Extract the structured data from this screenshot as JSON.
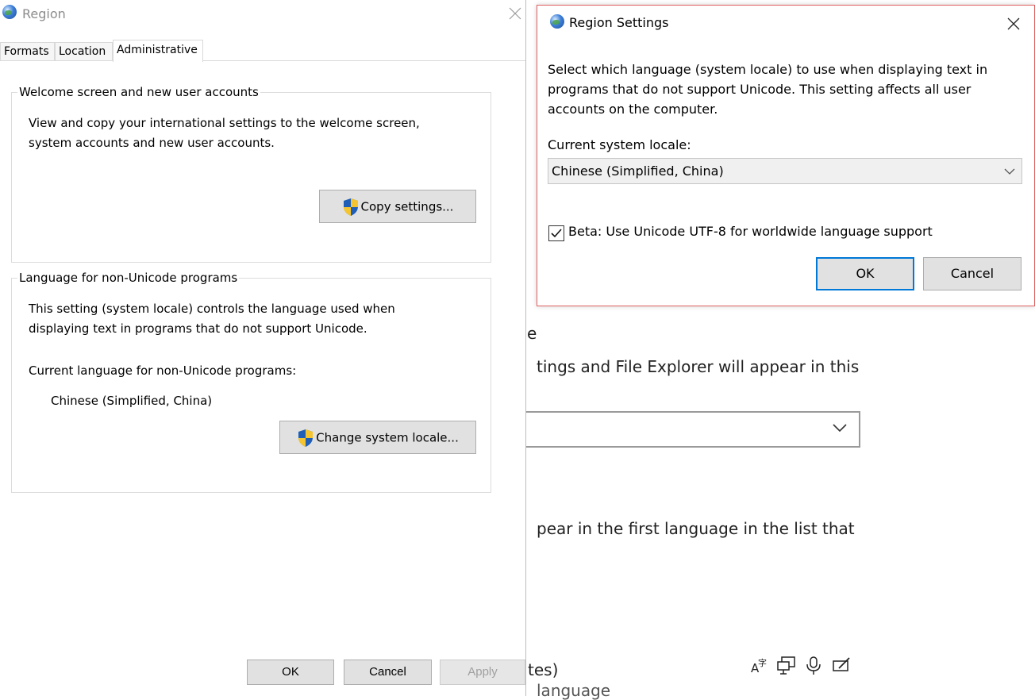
{
  "background_page": {
    "heading_fragment": "e",
    "line1_fragment": "tings and File Explorer will appear in this",
    "line2_fragment": "pear in the first language in the list that",
    "bottom_line1_fragment": "tes)",
    "bottom_line2_fragment": "language",
    "feature_icons": [
      "text-to-speech-icon",
      "display-icon",
      "microphone-icon",
      "handwriting-icon"
    ]
  },
  "region_dialog": {
    "title": "Region",
    "tabs": [
      {
        "label": "Formats"
      },
      {
        "label": "Location"
      },
      {
        "label": "Administrative"
      }
    ],
    "welcome_group": {
      "legend": "Welcome screen and new user accounts",
      "desc_line1": "View and copy your international settings to the welcome screen,",
      "desc_line2": "system accounts and new user accounts.",
      "button_label": "Copy settings..."
    },
    "non_unicode_group": {
      "legend": "Language for non-Unicode programs",
      "desc_line1": "This setting (system locale) controls the language used when",
      "desc_line2": "displaying text in programs that do not support Unicode.",
      "current_label": "Current language for non-Unicode programs:",
      "current_value": "Chinese (Simplified, China)",
      "button_label": "Change system locale..."
    },
    "footer": {
      "ok": "OK",
      "cancel": "Cancel",
      "apply": "Apply"
    }
  },
  "region_settings_dialog": {
    "title": "Region Settings",
    "desc_line1": "Select which language (system locale) to use when displaying text in",
    "desc_line2": "programs that do not support Unicode. This setting affects all user",
    "desc_line3": "accounts on the computer.",
    "locale_label": "Current system locale:",
    "locale_value": "Chinese (Simplified, China)",
    "beta_checkbox_label": "Beta: Use Unicode UTF-8 for worldwide language support",
    "beta_checked": true,
    "ok": "OK",
    "cancel": "Cancel",
    "border_color": "#e06060"
  }
}
